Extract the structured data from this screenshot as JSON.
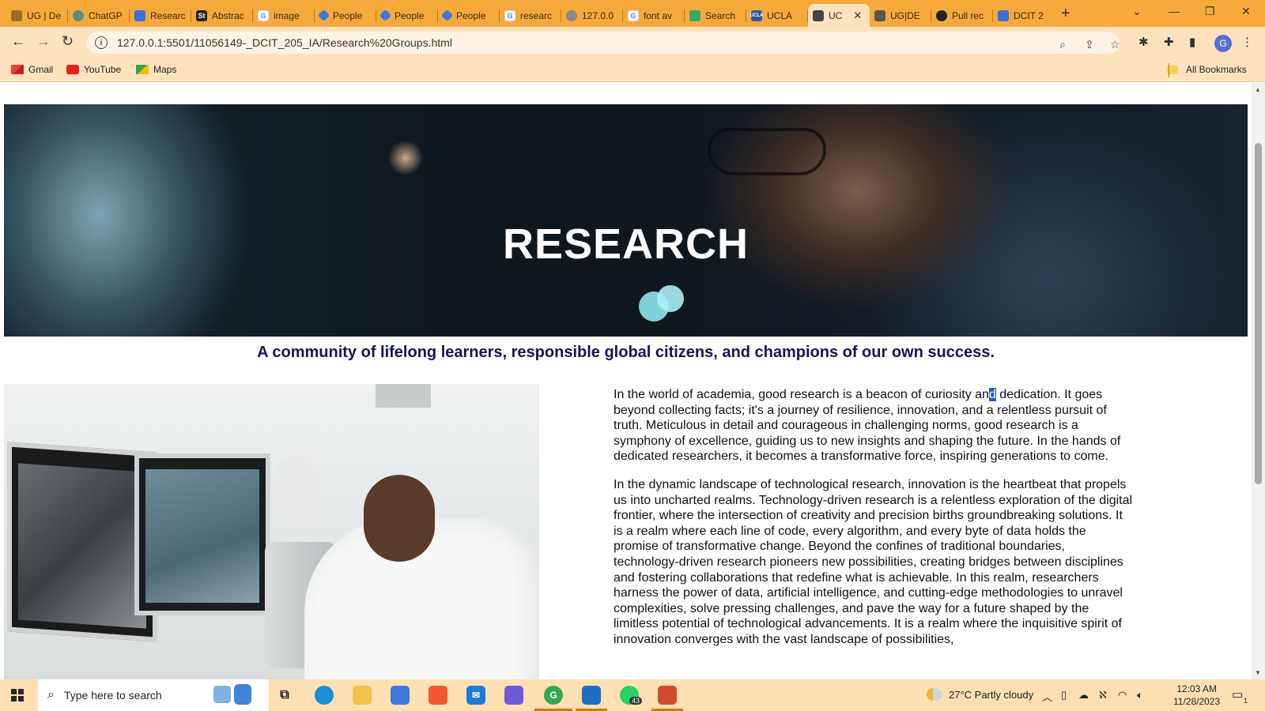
{
  "browser": {
    "tabs": [
      {
        "label": "UG | De",
        "color": "#9a6a2a"
      },
      {
        "label": "ChatGP",
        "color": "#5a8f7b"
      },
      {
        "label": "Researc",
        "color": "#3b6fd8"
      },
      {
        "label": "Abstrac",
        "color": "#222222"
      },
      {
        "label": "image",
        "color": "#4285f4"
      },
      {
        "label": "People",
        "color": "#3b7bd8"
      },
      {
        "label": "People",
        "color": "#3b7bd8"
      },
      {
        "label": "People",
        "color": "#3b7bd8"
      },
      {
        "label": "researc",
        "color": "#4285f4"
      },
      {
        "label": "127.0.0",
        "color": "#888888"
      },
      {
        "label": "font av",
        "color": "#4285f4"
      },
      {
        "label": "Search",
        "color": "#3aa76d"
      },
      {
        "label": "UCLA",
        "color": "#2a5ba8"
      },
      {
        "label": "UC",
        "color": "#444444",
        "active": true
      },
      {
        "label": "UG|DE",
        "color": "#555555"
      },
      {
        "label": "Pull rec",
        "color": "#222222"
      },
      {
        "label": "DCIT 2",
        "color": "#3b6fd8"
      }
    ],
    "url": "127.0.0.1:5501/11056149-_DCIT_205_IA/Research%20Groups.html",
    "profile_initial": "G",
    "bookmarks": [
      {
        "label": "Gmail"
      },
      {
        "label": "YouTube"
      },
      {
        "label": "Maps"
      }
    ],
    "all_bookmarks": "All Bookmarks"
  },
  "page": {
    "hero_title": "RESEARCH",
    "tagline": "A community of lifelong learners, responsible global citizens, and champions of our own success.",
    "paragraph1_before": "In the world of academia, good research is a beacon of curiosity an",
    "paragraph1_selected": "d",
    "paragraph1_after": " dedication. It goes beyond collecting facts; it's a journey of resilience, innovation, and a relentless pursuit of truth. Meticulous in detail and courageous in challenging norms, good research is a symphony of excellence, guiding us to new insights and shaping the future. In the hands of dedicated researchers, it becomes a transformative force, inspiring generations to come.",
    "paragraph2": "In the dynamic landscape of technological research, innovation is the heartbeat that propels us into uncharted realms. Technology-driven research is a relentless exploration of the digital frontier, where the intersection of creativity and precision births groundbreaking solutions. It is a realm where each line of code, every algorithm, and every byte of data holds the promise of transformative change. Beyond the confines of traditional boundaries, technology-driven research pioneers new possibilities, creating bridges between disciplines and fostering collaborations that redefine what is achievable. In this realm, researchers harness the power of data, artificial intelligence, and cutting-edge methodologies to unravel complexities, solve pressing challenges, and pave the way for a future shaped by the limitless potential of technological advancements. It is a realm where the inquisitive spirit of innovation converges with the vast landscape of possibilities,"
  },
  "taskbar": {
    "search_placeholder": "Type here to search",
    "whatsapp_badge": "43",
    "weather": "27°C  Partly cloudy",
    "time": "12:03 AM",
    "date": "11/28/2023",
    "notification_count": "1"
  }
}
